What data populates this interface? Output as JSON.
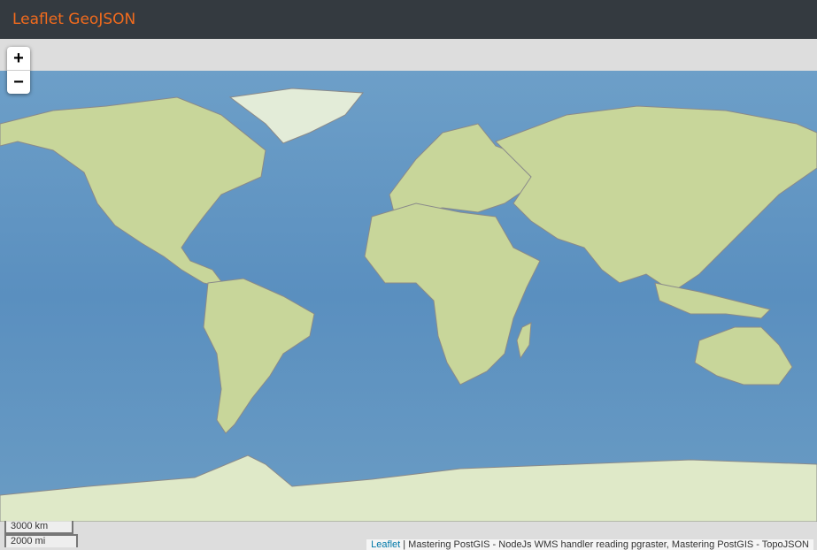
{
  "header": {
    "title": "Leaflet GeoJSON"
  },
  "controls": {
    "zoom_in": "+",
    "zoom_out": "−"
  },
  "scale": {
    "metric": "3000 km",
    "imperial": "2000 mi"
  },
  "attribution": {
    "leaflet_link": "Leaflet",
    "separator": " | ",
    "text": "Mastering PostGIS - NodeJs WMS handler reading pgraster, Mastering PostGIS - TopoJSON"
  },
  "colors": {
    "header_bg": "#343a40",
    "title": "#f26b1d",
    "ocean": "#5f93bf",
    "land": "#c9d79a",
    "ice": "#e6eef0",
    "border": "#8a8a8a"
  }
}
